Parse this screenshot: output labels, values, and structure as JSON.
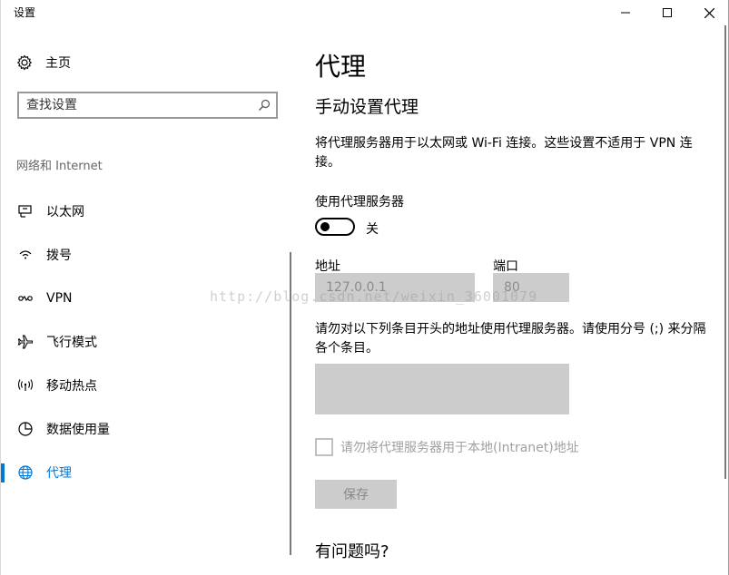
{
  "window": {
    "title": "设置",
    "controls": {
      "minimize": "minimize-icon",
      "maximize": "maximize-icon",
      "close": "close-icon"
    }
  },
  "sidebar": {
    "home_label": "主页",
    "search": {
      "placeholder": "查找设置",
      "value": ""
    },
    "section_label": "网络和 Internet",
    "items": [
      {
        "label": "以太网",
        "icon": "ethernet-icon"
      },
      {
        "label": "拨号",
        "icon": "dialup-icon"
      },
      {
        "label": "VPN",
        "icon": "vpn-icon"
      },
      {
        "label": "飞行模式",
        "icon": "airplane-icon"
      },
      {
        "label": "移动热点",
        "icon": "hotspot-icon"
      },
      {
        "label": "数据使用量",
        "icon": "data-usage-icon"
      },
      {
        "label": "代理",
        "icon": "globe-icon",
        "active": true
      }
    ],
    "accent_color": "#0078d7"
  },
  "main": {
    "title": "代理",
    "subtitle": "手动设置代理",
    "description": "将代理服务器用于以太网或 Wi-Fi 连接。这些设置不适用于 VPN 连接。",
    "use_proxy_label": "使用代理服务器",
    "toggle_state": "关",
    "address_label": "地址",
    "address_value": "127.0.0.1",
    "port_label": "端口",
    "port_value": "80",
    "exceptions_description": "请勿对以下列条目开头的地址使用代理服务器。请使用分号 (;) 来分隔各个条目。",
    "exceptions_value": "",
    "local_checkbox_label": "请勿将代理服务器用于本地(Intranet)地址",
    "save_label": "保存",
    "question": "有问题吗?"
  },
  "watermark": "http://blog.csdn.net/weixin_36001079"
}
